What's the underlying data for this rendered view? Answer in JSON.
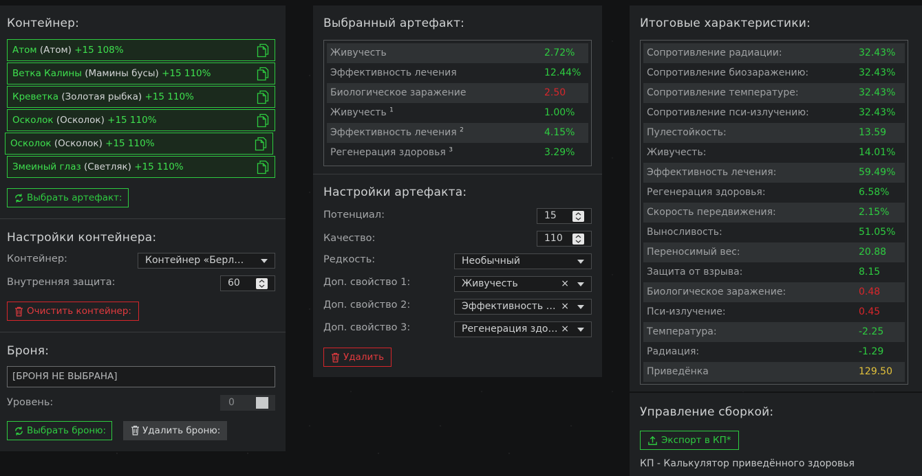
{
  "container": {
    "title": "Контейнер:",
    "items": [
      {
        "name": "Атом",
        "paren": "(Атом)",
        "bonus": "+15 108%"
      },
      {
        "name": "Ветка Калины",
        "paren": "(Мамины бусы)",
        "bonus": "+15 110%"
      },
      {
        "name": "Креветка",
        "paren": "(Золотая рыбка)",
        "bonus": "+15 110%"
      },
      {
        "name": "Осколок",
        "paren": "(Осколок)",
        "bonus": "+15 110%"
      },
      {
        "name": "Осколок",
        "paren": "(Осколок)",
        "bonus": "+15 110%"
      },
      {
        "name": "Змеиный глаз",
        "paren": "(Светляк)",
        "bonus": "+15 110%"
      }
    ],
    "select_button": "Выбрать артефакт:"
  },
  "container_settings": {
    "title": "Настройки контейнера:",
    "container_label": "Контейнер:",
    "container_value": "Контейнер «Берлога…",
    "protection_label": "Внутренняя защита:",
    "protection_value": "60",
    "clear_button": "Очистить контейнер:"
  },
  "armor": {
    "title": "Броня:",
    "field_value": "[БРОНЯ НЕ ВЫБРАНА]",
    "level_label": "Уровень:",
    "level_value": "0",
    "select_button": "Выбрать броню:",
    "delete_button": "Удалить броню:"
  },
  "artifact": {
    "title": "Выбранный артефакт:",
    "stats": [
      {
        "label": "Живучесть",
        "sup": "",
        "value": "2.72%",
        "color": "green"
      },
      {
        "label": "Эффективность лечения",
        "sup": "",
        "value": "12.44%",
        "color": "green"
      },
      {
        "label": "Биологическое заражение",
        "sup": "",
        "value": "2.50",
        "color": "red"
      },
      {
        "label": "Живучесть",
        "sup": "1",
        "value": "1.00%",
        "color": "green"
      },
      {
        "label": "Эффективность лечения",
        "sup": "2",
        "value": "4.15%",
        "color": "green"
      },
      {
        "label": "Регенерация здоровья",
        "sup": "3",
        "value": "3.29%",
        "color": "green"
      }
    ]
  },
  "artifact_settings": {
    "title": "Настройки артефакта:",
    "potential_label": "Потенциал:",
    "potential_value": "15",
    "quality_label": "Качество:",
    "quality_value": "110",
    "rarity_label": "Редкость:",
    "rarity_value": "Необычный",
    "prop1_label": "Доп. свойство 1:",
    "prop1_value": "Живучесть",
    "prop2_label": "Доп. свойство 2:",
    "prop2_value": "Эффективность лечения",
    "prop3_label": "Доп. свойство 3:",
    "prop3_value": "Регенерация здоровья",
    "clear_symbol": "×",
    "delete_button": "Удалить"
  },
  "totals": {
    "title": "Итоговые характеристики:",
    "stats": [
      {
        "label": "Сопротивление радиации:",
        "value": "32.43%",
        "color": "green"
      },
      {
        "label": "Сопротивление биозаражению:",
        "value": "32.43%",
        "color": "green"
      },
      {
        "label": "Сопротивление температуре:",
        "value": "32.43%",
        "color": "green"
      },
      {
        "label": "Сопротивление пси-излучению:",
        "value": "32.43%",
        "color": "green"
      },
      {
        "label": "Пулестойкость:",
        "value": "13.59",
        "color": "green"
      },
      {
        "label": "Живучесть:",
        "value": "14.01%",
        "color": "green"
      },
      {
        "label": "Эффективность лечения:",
        "value": "59.49%",
        "color": "green"
      },
      {
        "label": "Регенерация здоровья:",
        "value": "6.58%",
        "color": "green"
      },
      {
        "label": "Скорость передвижения:",
        "value": "2.15%",
        "color": "green"
      },
      {
        "label": "Выносливость:",
        "value": "51.05%",
        "color": "green"
      },
      {
        "label": "Переносимый вес:",
        "value": "20.88",
        "color": "green"
      },
      {
        "label": "Защита от взрыва:",
        "value": "8.15",
        "color": "green"
      },
      {
        "label": "Биологическое заражение:",
        "value": "0.48",
        "color": "red"
      },
      {
        "label": "Пси-излучение:",
        "value": "0.45",
        "color": "red"
      },
      {
        "label": "Температура:",
        "value": "-2.25",
        "color": "green"
      },
      {
        "label": "Радиация:",
        "value": "-1.29",
        "color": "green"
      },
      {
        "label": "Приведёнка",
        "value": "129.50",
        "color": "yellow"
      }
    ]
  },
  "build": {
    "title": "Управление сборкой:",
    "export_button": "Экспорт в КП*",
    "footnote": "КП - Калькулятор приведённого здоровья"
  },
  "colors": {
    "accent_green": "#2ecc40",
    "danger_red": "#d8262b",
    "highlight_yellow": "#e3c23b",
    "panel_bg": "#1f2123"
  }
}
